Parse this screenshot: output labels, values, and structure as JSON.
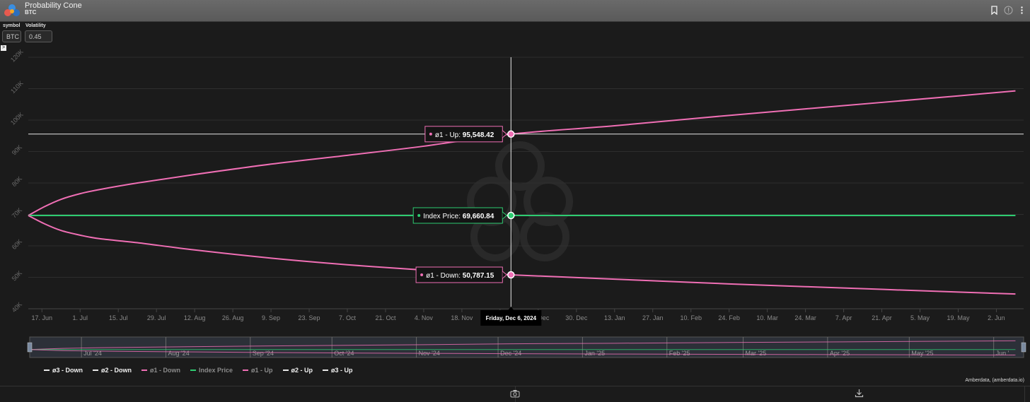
{
  "app": {
    "title": "Probability Cone",
    "subtitle": "BTC",
    "logo_icon": "amberdata-logo-icon",
    "header_icons": [
      "bookmark-icon",
      "info-icon",
      "more-icon"
    ]
  },
  "params": {
    "symbol_label": "symbol",
    "symbol_value": "BTC",
    "volatility_label": "Volatility",
    "volatility_value": "0.45",
    "collapse_glyph": ">"
  },
  "colors": {
    "background": "#1b1b1b",
    "sigma1": "#f06fb5",
    "index": "#2ecc71",
    "crosshair": "#e8e8e8",
    "grid": "#2e2e2e"
  },
  "chart_data": {
    "type": "line",
    "ylim": [
      40000,
      120000
    ],
    "yticks": [
      "40K",
      "50K",
      "60K",
      "70K",
      "80K",
      "90K",
      "100K",
      "110K",
      "120K"
    ],
    "xtick_labels": [
      "17. Jun",
      "1. Jul",
      "15. Jul",
      "29. Jul",
      "12. Aug",
      "26. Aug",
      "9. Sep",
      "23. Sep",
      "7. Oct",
      "21. Oct",
      "4. Nov",
      "18. Nov",
      "2. Dec",
      "16. Dec",
      "30. Dec",
      "13. Jan",
      "27. Jan",
      "10. Feb",
      "24. Feb",
      "10. Mar",
      "24. Mar",
      "7. Apr",
      "21. Apr",
      "5. May",
      "19. May",
      "2. Jun"
    ],
    "xtick_dates": [
      "2024-06-17",
      "2024-07-01",
      "2024-07-15",
      "2024-07-29",
      "2024-08-12",
      "2024-08-26",
      "2024-09-09",
      "2024-09-23",
      "2024-10-07",
      "2024-10-21",
      "2024-11-04",
      "2024-11-18",
      "2024-12-02",
      "2024-12-16",
      "2024-12-30",
      "2025-01-13",
      "2025-01-27",
      "2025-02-10",
      "2025-02-24",
      "2025-03-10",
      "2025-03-24",
      "2025-04-07",
      "2025-04-21",
      "2025-05-05",
      "2025-05-19",
      "2025-06-02"
    ],
    "x_start": "2024-06-12",
    "x_end": "2025-06-12",
    "series": [
      {
        "name": "ø1 - Up",
        "color": "#f06fb5",
        "points": [
          [
            "2024-06-12",
            69660
          ],
          [
            "2024-06-18",
            72500
          ],
          [
            "2024-06-24",
            74800
          ],
          [
            "2024-07-01",
            76600
          ],
          [
            "2024-07-08",
            77900
          ],
          [
            "2024-07-22",
            80000
          ],
          [
            "2024-08-12",
            82700
          ],
          [
            "2024-09-09",
            86000
          ],
          [
            "2024-10-07",
            88800
          ],
          [
            "2024-11-04",
            91700
          ],
          [
            "2024-12-06",
            95548.42
          ],
          [
            "2025-01-13",
            98200
          ],
          [
            "2025-02-24",
            101500
          ],
          [
            "2025-04-07",
            104600
          ],
          [
            "2025-05-19",
            107700
          ],
          [
            "2025-06-09",
            109300
          ]
        ]
      },
      {
        "name": "Index Price",
        "color": "#2ecc71",
        "points": [
          [
            "2024-06-12",
            69660.84
          ],
          [
            "2025-06-09",
            69660.84
          ]
        ]
      },
      {
        "name": "ø1 - Down",
        "color": "#f06fb5",
        "points": [
          [
            "2024-06-12",
            69660
          ],
          [
            "2024-06-18",
            67000
          ],
          [
            "2024-06-24",
            64900
          ],
          [
            "2024-07-01",
            63400
          ],
          [
            "2024-07-08",
            62300
          ],
          [
            "2024-07-22",
            61000
          ],
          [
            "2024-08-12",
            58700
          ],
          [
            "2024-09-09",
            56100
          ],
          [
            "2024-10-07",
            54000
          ],
          [
            "2024-11-04",
            52300
          ],
          [
            "2024-12-06",
            50787.15
          ],
          [
            "2025-01-13",
            49400
          ],
          [
            "2025-02-24",
            47900
          ],
          [
            "2025-04-07",
            46600
          ],
          [
            "2025-05-19",
            45300
          ],
          [
            "2025-06-09",
            44700
          ]
        ]
      }
    ],
    "crosshair": {
      "date": "2024-12-06",
      "date_label": "Friday, Dec 6, 2024",
      "tooltips": [
        {
          "label": "ø1 - Up: ",
          "value": "95,548.42",
          "y": 95548.42,
          "color": "#f06fb5"
        },
        {
          "label": "Index Price: ",
          "value": "69,660.84",
          "y": 69660.84,
          "color": "#2ecc71"
        },
        {
          "label": "ø1 - Down: ",
          "value": "50,787.15",
          "y": 50787.15,
          "color": "#f06fb5"
        }
      ]
    },
    "navigator_labels": [
      "Jul '24",
      "Aug '24",
      "Sep '24",
      "Oct '24",
      "Nov '24",
      "Dec '24",
      "Jan '25",
      "Feb '25",
      "Mar '25",
      "Apr '25",
      "May '25",
      "Jun '..."
    ],
    "navigator_dates": [
      "2024-07-01",
      "2024-08-01",
      "2024-09-01",
      "2024-10-01",
      "2024-11-01",
      "2024-12-01",
      "2025-01-01",
      "2025-02-01",
      "2025-03-01",
      "2025-04-01",
      "2025-05-01",
      "2025-06-01"
    ],
    "legend": [
      {
        "label": "ø3 - Down",
        "color": "#e8e8e8"
      },
      {
        "label": "ø2 - Down",
        "color": "#e8e8e8"
      },
      {
        "label": "ø1 - Down",
        "color": "#f06fb5"
      },
      {
        "label": "Index Price",
        "color": "#2ecc71"
      },
      {
        "label": "ø1 - Up",
        "color": "#f06fb5"
      },
      {
        "label": "ø2 - Up",
        "color": "#e8e8e8"
      },
      {
        "label": "ø3 - Up",
        "color": "#e8e8e8"
      }
    ],
    "legend_text_colors": [
      "#f0f0f0",
      "#f0f0f0",
      "#8a8a8a",
      "#8a8a8a",
      "#8a8a8a",
      "#f0f0f0",
      "#f0f0f0"
    ]
  },
  "footer": {
    "credit": "Amberdata, (amberdata.io)",
    "icons": [
      "camera-icon",
      "download-icon"
    ]
  }
}
